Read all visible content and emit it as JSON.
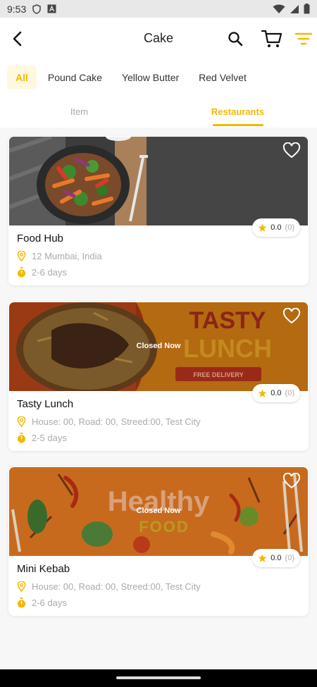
{
  "status": {
    "time": "9:53"
  },
  "header": {
    "title": "Cake"
  },
  "chips": [
    {
      "label": "All"
    },
    {
      "label": "Pound Cake"
    },
    {
      "label": "Yellow Butter"
    },
    {
      "label": "Red Velvet"
    }
  ],
  "tabs": [
    {
      "label": "Item"
    },
    {
      "label": "Restaurants"
    }
  ],
  "restaurants": [
    {
      "name": "Food Hub",
      "address": "12 Mumbai, India",
      "delivery_time": "2-6 days",
      "rating": "0.0",
      "rating_count": "(0)",
      "status": ""
    },
    {
      "name": "Tasty Lunch",
      "address": "House: 00, Road: 00, Streed:00, Test City",
      "delivery_time": "2-5 days",
      "rating": "0.0",
      "rating_count": "(0)",
      "status": "Closed Now",
      "banner_title_1": "TASTY",
      "banner_title_2": "LUNCH",
      "banner_tag": "FREE DELIVERY"
    },
    {
      "name": "Mini Kebab",
      "address": "House: 00, Road: 00, Streed:00, Test City",
      "delivery_time": "2-6 days",
      "rating": "0.0",
      "rating_count": "(0)",
      "status": "Closed Now",
      "banner_title_1": "Healthy",
      "banner_title_2": "FOOD"
    }
  ],
  "colors": {
    "accent": "#f5b800",
    "chip_active_bg": "#fff8e0",
    "muted_text": "#aaaaaa"
  }
}
